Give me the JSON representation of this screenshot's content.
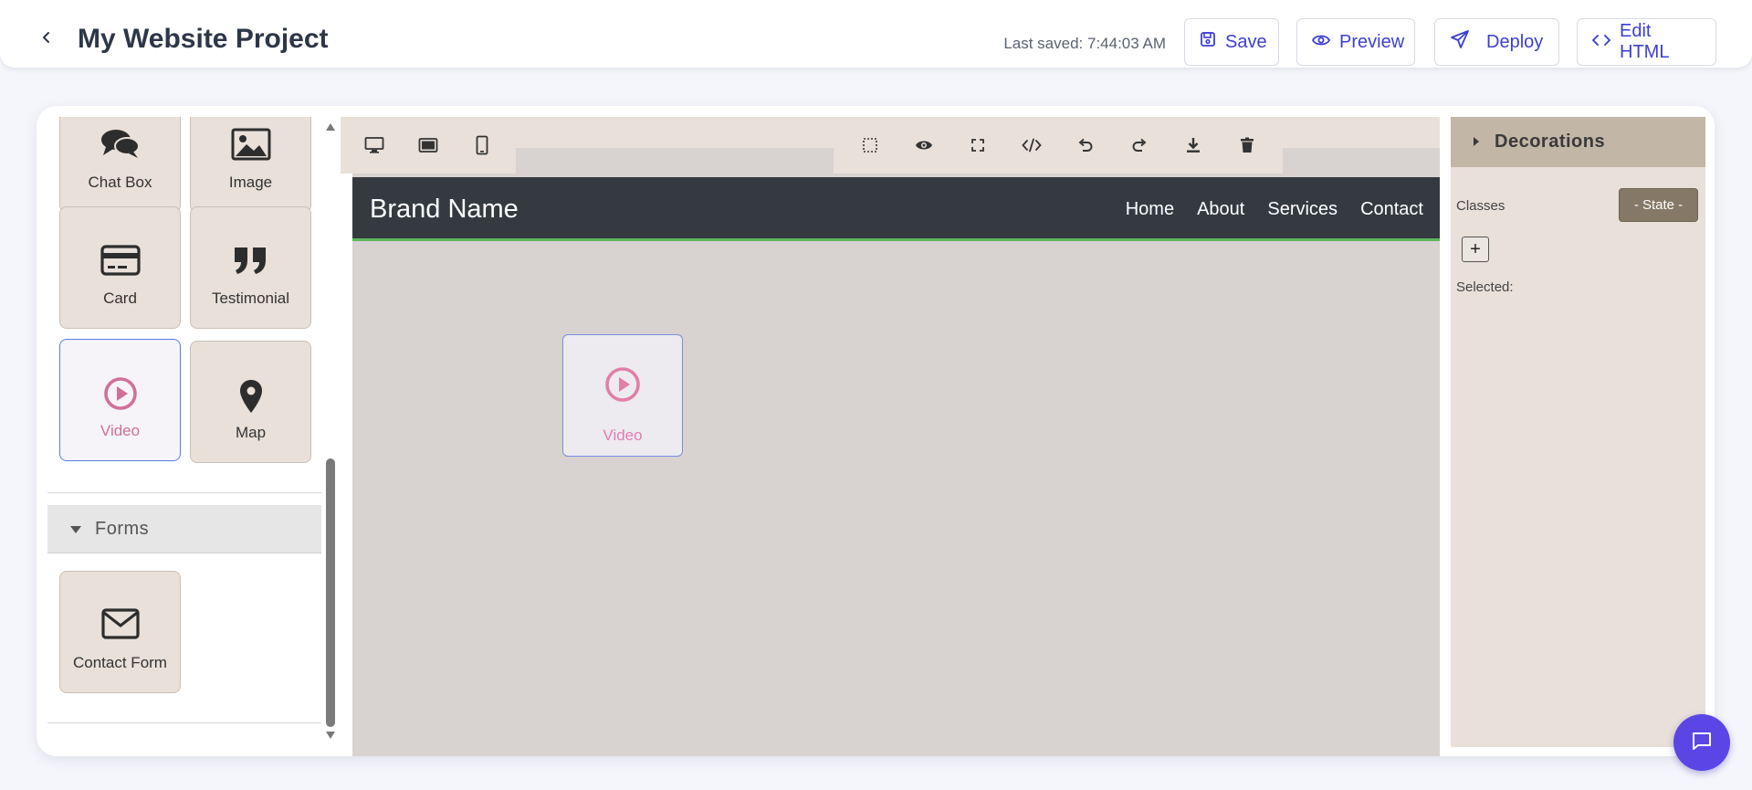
{
  "header": {
    "title": "My Website Project",
    "last_saved": "Last saved: 7:44:03 AM",
    "buttons": {
      "save": "Save",
      "preview": "Preview",
      "deploy": "Deploy",
      "edit_html": "Edit HTML"
    },
    "accent_color": "#3b3fd1"
  },
  "blocks": {
    "items": [
      {
        "label": "Chat Box",
        "icon": "comments-icon"
      },
      {
        "label": "Image",
        "icon": "image-icon"
      },
      {
        "label": "Card",
        "icon": "credit-card-icon"
      },
      {
        "label": "Testimonial",
        "icon": "quote-icon"
      },
      {
        "label": "Video",
        "icon": "play-circle-icon",
        "selected": true
      },
      {
        "label": "Map",
        "icon": "map-marker-icon"
      }
    ],
    "forms_section": "Forms",
    "forms_items": [
      {
        "label": "Contact Form",
        "icon": "envelope-icon"
      }
    ]
  },
  "canvas": {
    "devices": [
      "desktop-icon",
      "tablet-icon",
      "mobile-icon"
    ],
    "tools": [
      "sw-visibility-icon",
      "preview-icon",
      "fullscreen-icon",
      "code-icon",
      "undo-icon",
      "redo-icon",
      "download-icon",
      "trash-icon"
    ],
    "site": {
      "brand": "Brand Name",
      "nav": [
        "Home",
        "About",
        "Services",
        "Contact"
      ]
    },
    "dropped_element": {
      "label": "Video",
      "icon": "play-circle-icon"
    }
  },
  "style_manager": {
    "section": "Decorations",
    "classes_label": "Classes",
    "state_select": "- State -",
    "add_button": "+",
    "selected_label": "Selected:"
  },
  "colors": {
    "nav_bg": "#343a40",
    "panel_bg": "#e8e0d9",
    "video_pink": "#e07fa8",
    "fab": "#5b46e5"
  }
}
